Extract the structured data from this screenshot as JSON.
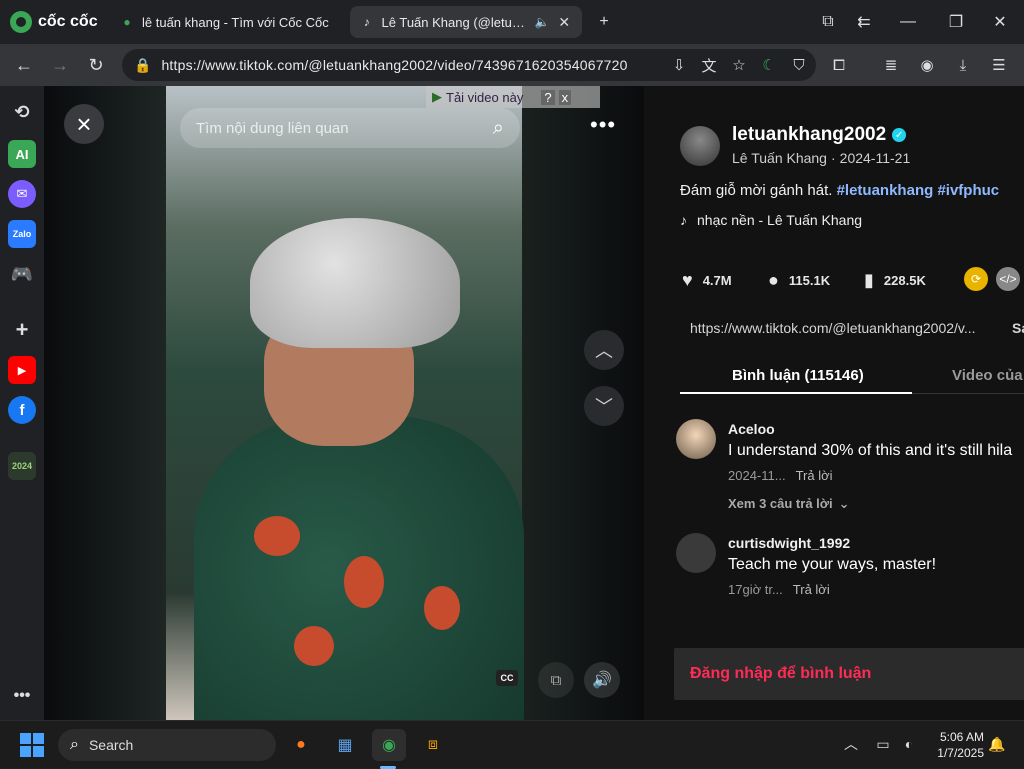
{
  "browser": {
    "brand": "cốc cốc",
    "tabs": [
      {
        "title": "lê tuấn khang - Tìm với Cốc Cốc",
        "active": false
      },
      {
        "title": "Lê Tuấn Khang (@letuanl",
        "active": true
      }
    ],
    "url": "https://www.tiktok.com/@letuankhang2002/video/7439671620354067720"
  },
  "player": {
    "search_placeholder": "Tìm nội dung liên quan",
    "download_banner": "Tải video này",
    "download_help": "?",
    "download_close": "x",
    "cc_label": "CC"
  },
  "post": {
    "username": "letuankhang2002",
    "display_name": "Lê Tuấn Khang",
    "date": "2024-11-21",
    "caption_text": "Đám giỗ mời gánh hát. ",
    "hashtags": [
      "#letuankhang",
      "#ivfphuc"
    ],
    "music": "nhạc nền - Lê Tuấn Khang",
    "likes": "4.7M",
    "comments": "115.1K",
    "saves": "228.5K",
    "link": "https://www.tiktok.com/@letuankhang2002/v...",
    "link_button": "Sa"
  },
  "tabs": {
    "comments_tab": "Bình luận (115146)",
    "videos_tab": "Video của n"
  },
  "comments": [
    {
      "user": "Aceloo",
      "text": "I understand 30% of this and it's still hila",
      "time": "2024-11...",
      "reply": "Trả lời",
      "view_replies": "Xem 3 câu trả lời"
    },
    {
      "user": "curtisdwight_1992",
      "text": "Teach me your ways, master!",
      "time": "17giờ tr...",
      "reply": "Trả lời"
    }
  ],
  "login_prompt": "Đăng nhập để bình luận",
  "taskbar": {
    "search_placeholder": "Search",
    "time": "5:06 AM",
    "date": "1/7/2025"
  },
  "colors": {
    "accent": "#fe2c55",
    "hashtag": "#8fb9ff",
    "verified": "#20d5ec",
    "browser_green": "#3aa757"
  }
}
